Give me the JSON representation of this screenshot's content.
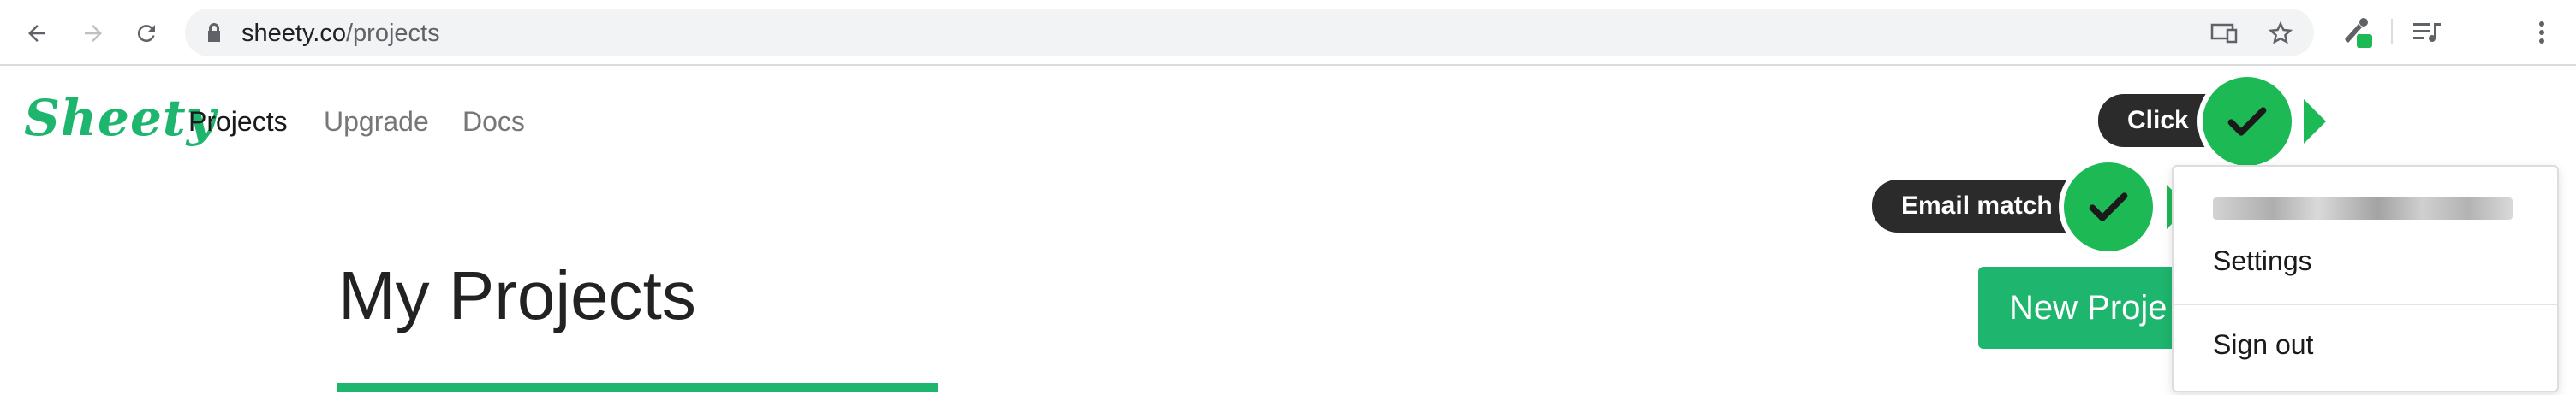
{
  "browser": {
    "url_host": "sheety.co",
    "url_path": "/projects"
  },
  "site": {
    "logo": "Sheety",
    "nav": [
      "Projects",
      "Upgrade",
      "Docs"
    ]
  },
  "tags": {
    "click": "Click",
    "email_match": "Email match"
  },
  "main": {
    "title": "My Projects",
    "new_project_button": "New Proje"
  },
  "dropdown": {
    "items": [
      "Settings",
      "Sign out"
    ]
  },
  "colors": {
    "brand": "#1eb56e",
    "check": "#1db954",
    "tag_bg": "#2b2b2b"
  },
  "icons": [
    "back-arrow-icon",
    "forward-arrow-icon",
    "reload-icon",
    "lock-icon",
    "cast-icon",
    "star-icon",
    "eyedropper-extension-icon",
    "media-queue-icon",
    "menu-dots-icon",
    "checkmark-icon"
  ]
}
